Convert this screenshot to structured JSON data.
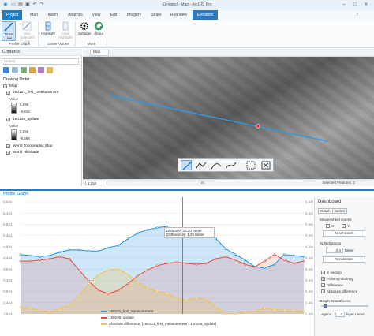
{
  "window": {
    "title": "Elevated - Map - ArcGIS Pro",
    "signin": "?"
  },
  "ribbon_tabs": [
    "Project",
    "Map",
    "Insert",
    "Analysis",
    "View",
    "Edit",
    "Imagery",
    "Share",
    "RealView",
    "Elevation"
  ],
  "ribbon": {
    "draw_line": "Draw Line",
    "use_selected_line": "Use Selected Line",
    "highlight": "Highlight",
    "clear_highlight": "Clear Highlight",
    "settings": "Settings",
    "about": "About",
    "group_profile_graph": "Profile Graph",
    "group_lower_values": "Lower Values",
    "group_more": "More"
  },
  "contents": {
    "title": "Contents",
    "search_placeholder": "Search",
    "drawing_order": "Drawing Order",
    "layers": {
      "map": "Map",
      "layer1": "190101_first_measurement",
      "layer1_value_label": "Value",
      "layer1_max": "5,896",
      "layer1_min": "-8,916",
      "layer2": "190106_update",
      "layer2_value_label": "Value",
      "layer2_max": "5,556",
      "layer2_min": "-8,568",
      "topo": "World Topographic Map",
      "hillshade": "World Hillshade"
    }
  },
  "map": {
    "tab": "Map",
    "scale": "1:258",
    "coord_suffix": "m",
    "selected_features": "Selected Features: 0"
  },
  "profile_graph": {
    "title": "Profile Graph",
    "tooltip_line1": "Distance: 33,20 Meter",
    "tooltip_line2": "[Difference]: 1,29 Meter"
  },
  "chart_data": {
    "type": "area",
    "y_tick_labels": [
      "6,944",
      "6,444",
      "5,944",
      "5,444",
      "4,944",
      "4,444",
      "3,944",
      "3,444",
      "2,944",
      "2,444",
      "1,944"
    ],
    "ylim": [
      1.944,
      6.944
    ],
    "xlim": [
      0,
      58
    ],
    "cursor_x": 33.2,
    "series": [
      {
        "name": "190101_first_measurement",
        "color": "#1e90e0",
        "x": [
          0,
          2,
          4,
          6,
          8,
          10,
          12,
          14,
          16,
          18,
          20,
          22,
          24,
          26,
          28,
          30,
          32,
          34,
          36,
          38,
          40,
          42,
          44,
          46,
          48,
          50,
          52,
          54,
          56,
          58
        ],
        "y": [
          4.6,
          4.55,
          4.5,
          4.55,
          4.7,
          4.8,
          4.8,
          4.75,
          4.75,
          4.9,
          5.0,
          5.3,
          5.55,
          5.7,
          5.8,
          5.85,
          5.6,
          5.45,
          5.6,
          5.55,
          5.3,
          4.85,
          4.6,
          4.35,
          4.05,
          4.0,
          4.15,
          4.6,
          4.55,
          4.5
        ]
      },
      {
        "name": "190106_update",
        "color": "#e8483b",
        "x": [
          0,
          2,
          4,
          6,
          8,
          10,
          12,
          14,
          16,
          18,
          20,
          22,
          24,
          26,
          28,
          30,
          32,
          34,
          36,
          38,
          40,
          42,
          44,
          46,
          48,
          50,
          52,
          54,
          56,
          58
        ],
        "y": [
          4.3,
          4.3,
          4.35,
          4.4,
          4.5,
          4.4,
          3.9,
          3.4,
          3.0,
          2.85,
          3.0,
          3.3,
          3.65,
          3.9,
          4.1,
          4.2,
          4.25,
          4.2,
          4.15,
          4.2,
          4.4,
          4.5,
          4.35,
          4.15,
          4.05,
          4.3,
          4.6,
          4.35,
          4.2,
          4.3
        ]
      },
      {
        "name": "Absolute difference: [190101_first_measurement - 190106_update]",
        "color": "#f2c14e",
        "x": [
          0,
          2,
          4,
          6,
          8,
          10,
          12,
          14,
          16,
          18,
          20,
          22,
          24,
          26,
          28,
          30,
          32,
          34,
          36,
          38,
          40,
          42,
          44,
          46,
          48,
          50,
          52,
          54,
          56,
          58
        ],
        "y": [
          2.25,
          2.2,
          2.1,
          2.05,
          2.15,
          2.35,
          2.75,
          3.3,
          3.7,
          3.9,
          3.95,
          3.7,
          3.35,
          3.1,
          2.95,
          2.85,
          2.65,
          2.55,
          2.65,
          2.6,
          2.25,
          1.95,
          1.95,
          2.05,
          2.05,
          2.2,
          2.15,
          2.1,
          2.1,
          2.05
        ]
      }
    ]
  },
  "dashboard": {
    "title": "Dashboard",
    "tab_graph": "Graph",
    "tab_series": "Series",
    "mousewheel_zooms": "Mousewheel zooms",
    "axis_x": "X",
    "axis_y": "Y",
    "reset_zoom": "Reset Zoom",
    "split_distance": "Split distance",
    "split_value": "0,4",
    "split_unit": "Meter",
    "recalculate": "Recalculate",
    "x_section": "X section",
    "point_symbology": "Point symbology",
    "difference": "Difference",
    "absolute_difference": "Absolute difference",
    "graph_smoothness": "Graph Smoothness",
    "legend_label": "Legend",
    "legend_value": "4",
    "layer_name": "layer name"
  }
}
